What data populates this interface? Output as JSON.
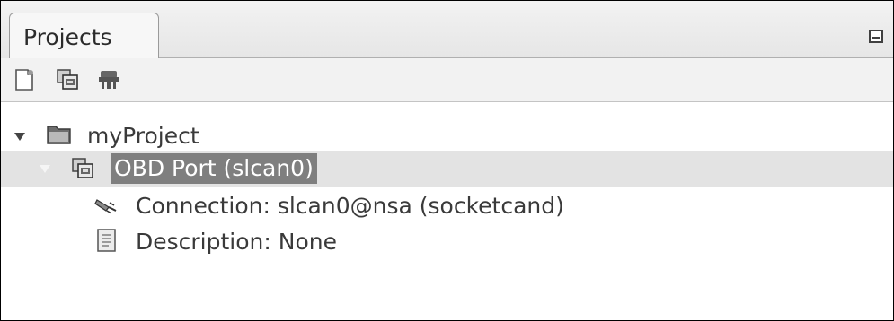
{
  "panel": {
    "tab_label": "Projects",
    "minimize_icon": "minimize-icon"
  },
  "toolbar": {
    "buttons": [
      {
        "icon": "new-project-icon"
      },
      {
        "icon": "add-port-icon"
      },
      {
        "icon": "device-icon"
      }
    ]
  },
  "tree": {
    "project": {
      "label": "myProject",
      "icon": "folder-icon",
      "expanded": true
    },
    "port": {
      "label": "OBD Port (slcan0)",
      "icon": "port-icon",
      "expanded": true,
      "selected": true
    },
    "connection": {
      "label": "Connection: slcan0@nsa (socketcand)",
      "icon": "plug-icon"
    },
    "description": {
      "label": "Description: None",
      "icon": "document-icon"
    }
  },
  "colors": {
    "selection_bg": "#7f7f7f",
    "row_highlight": "#e3e3e3",
    "text": "#3a3a3a"
  }
}
